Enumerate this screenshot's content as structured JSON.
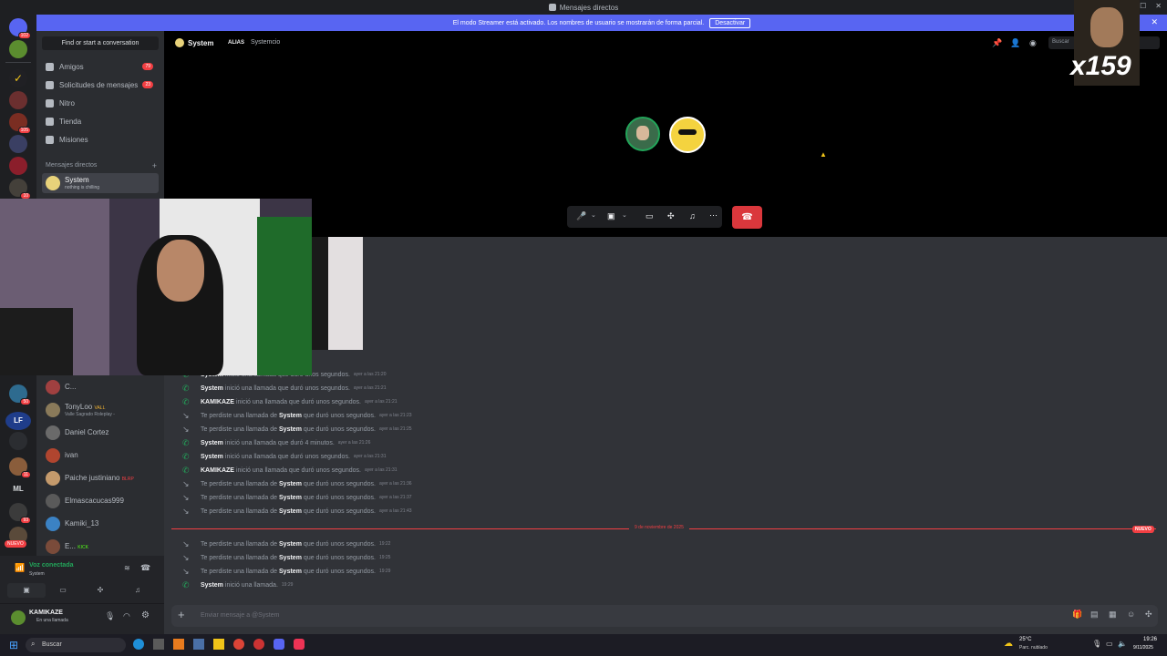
{
  "window": {
    "title": "Mensajes directos"
  },
  "banner": {
    "text": "El modo Streamer está activado. Los nombres de usuario se mostrarán de forma parcial.",
    "button": "Desactivar"
  },
  "servers": {
    "badges": [
      "102",
      "105",
      "10",
      "50",
      "11",
      "93"
    ],
    "lf": "LF",
    "ml": "ML",
    "new_label": "NUEVO"
  },
  "sidebar": {
    "find": "Find or start a conversation",
    "nav": [
      {
        "label": "Amigos",
        "count": "79"
      },
      {
        "label": "Solicitudes de mensajes",
        "count": "23"
      },
      {
        "label": "Nitro",
        "count": ""
      },
      {
        "label": "Tienda",
        "count": ""
      },
      {
        "label": "Misiones",
        "count": ""
      }
    ],
    "dm_header": "Mensajes directos",
    "active_dm": {
      "name": "System",
      "status": "nothing is chilling"
    },
    "dms": [
      {
        "name": "C...",
        "sub": ""
      },
      {
        "name": "TonyLoo",
        "tag": "VALL",
        "sub": "Valle Sagrado Roleplay -"
      },
      {
        "name": "Daniel Cortez",
        "sub": ""
      },
      {
        "name": "ivan",
        "sub": ""
      },
      {
        "name": "Paiche justiniano",
        "tag": "BLRP",
        "sub": ""
      },
      {
        "name": "Elmascacucas999",
        "sub": ""
      },
      {
        "name": "Kamiki_13",
        "sub": ""
      },
      {
        "name": "E...",
        "tag": "KICK",
        "sub": ""
      }
    ]
  },
  "voice": {
    "status": "Voz conectada",
    "channel": "System"
  },
  "user": {
    "name": "KAMIKAZE",
    "status": "En una llamada"
  },
  "header": {
    "channel": "System",
    "alias_label": "ALIAS",
    "alias": "Systemcio",
    "search": "Buscar"
  },
  "overlay": {
    "counter": "x159"
  },
  "messages_day1": [
    {
      "type": "start",
      "who": "System",
      "text": "inició una llamada que duró unos segundos.",
      "time": "ayer a las 21:20"
    },
    {
      "type": "start",
      "who": "System",
      "text": "inició una llamada que duró unos segundos.",
      "time": "ayer a las 21:21"
    },
    {
      "type": "start",
      "who": "KAMIKAZE",
      "text": "inició una llamada que duró unos segundos.",
      "time": "ayer a las 21:21"
    },
    {
      "type": "missed",
      "pre": "Te perdiste una llamada de",
      "who": "System",
      "text": "que duró unos segundos.",
      "time": "ayer a las 21:23"
    },
    {
      "type": "missed",
      "pre": "Te perdiste una llamada de",
      "who": "System",
      "text": "que duró unos segundos.",
      "time": "ayer a las 21:25"
    },
    {
      "type": "start",
      "who": "System",
      "text": "inició una llamada que duró 4 minutos.",
      "time": "ayer a las 21:26"
    },
    {
      "type": "start",
      "who": "System",
      "text": "inició una llamada que duró unos segundos.",
      "time": "ayer a las 21:31"
    },
    {
      "type": "start",
      "who": "KAMIKAZE",
      "text": "inició una llamada que duró unos segundos.",
      "time": "ayer a las 21:31"
    },
    {
      "type": "missed",
      "pre": "Te perdiste una llamada de",
      "who": "System",
      "text": "que duró unos segundos.",
      "time": "ayer a las 21:36"
    },
    {
      "type": "missed",
      "pre": "Te perdiste una llamada de",
      "who": "System",
      "text": "que duró unos segundos.",
      "time": "ayer a las 21:37"
    },
    {
      "type": "missed",
      "pre": "Te perdiste una llamada de",
      "who": "System",
      "text": "que duró unos segundos.",
      "time": "ayer a las 21:43"
    }
  ],
  "divider": {
    "date": "9 de noviembre de 2025",
    "badge": "NUEVO"
  },
  "messages_day2": [
    {
      "type": "missed",
      "pre": "Te perdiste una llamada de",
      "who": "System",
      "text": "que duró unos segundos.",
      "time": "19:22"
    },
    {
      "type": "missed",
      "pre": "Te perdiste una llamada de",
      "who": "System",
      "text": "que duró unos segundos.",
      "time": "19:25"
    },
    {
      "type": "missed",
      "pre": "Te perdiste una llamada de",
      "who": "System",
      "text": "que duró unos segundos.",
      "time": "19:29"
    },
    {
      "type": "start",
      "who": "System",
      "text": "inició una llamada.",
      "time": "19:29"
    }
  ],
  "composer": {
    "placeholder": "Enviar mensaje a @System"
  },
  "taskbar": {
    "search": "Buscar",
    "weather_temp": "25°C",
    "weather_desc": "Parc. nublado",
    "time": "19:26",
    "date": "9/11/2025"
  },
  "colors": {
    "blurple": "#5865f2",
    "green": "#23a55a",
    "red": "#da373c",
    "bg": "#313338"
  }
}
